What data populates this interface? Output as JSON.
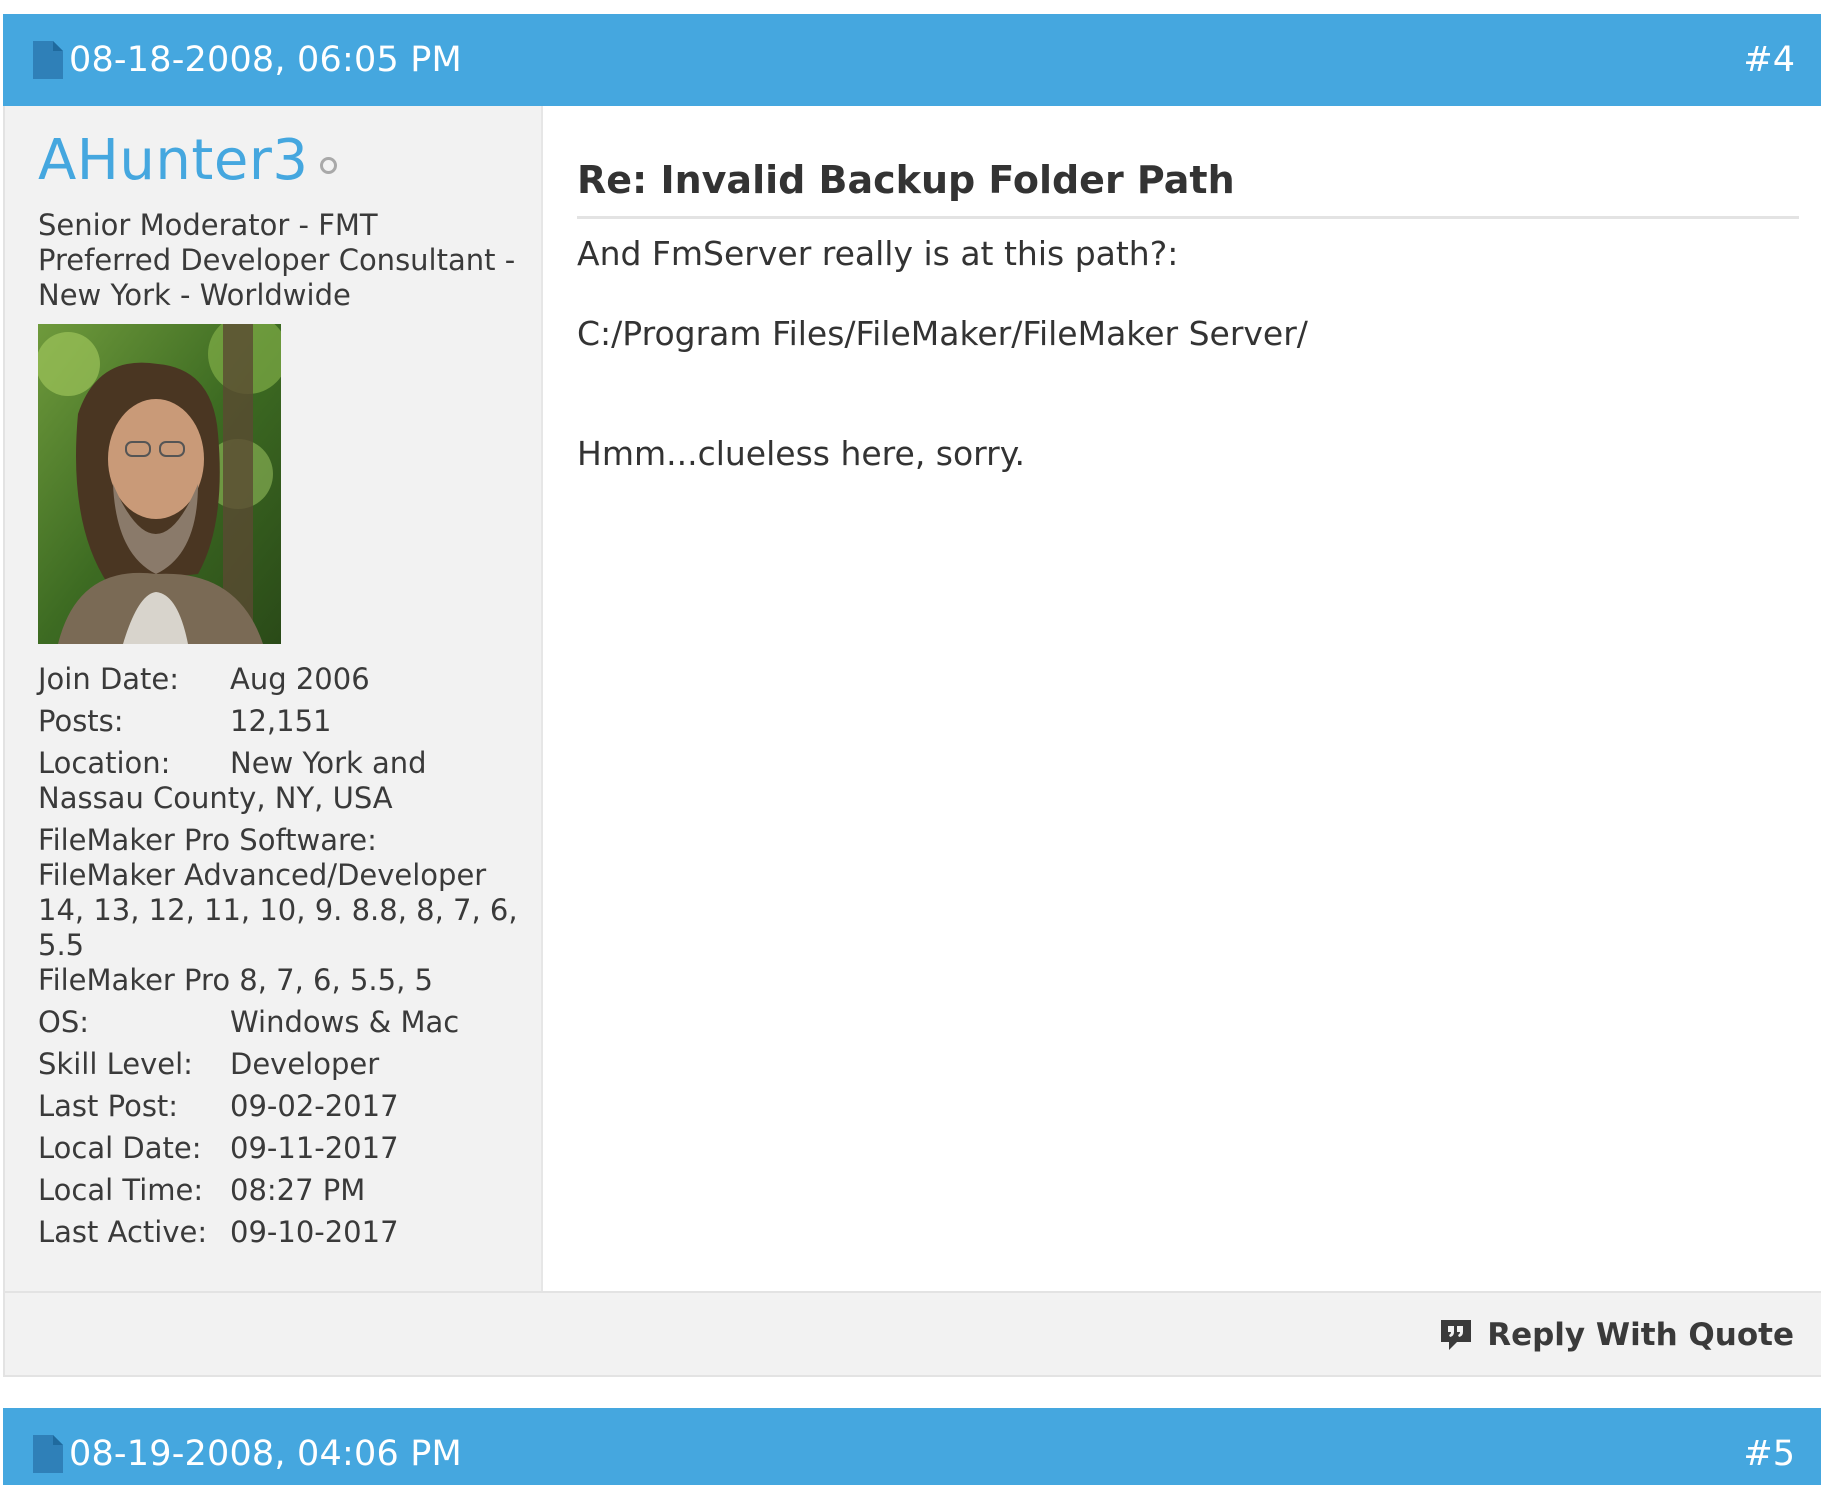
{
  "posts": [
    {
      "date": "08-18-2008, 06:05 PM",
      "number": "#4",
      "author": {
        "username": "AHunter3",
        "title": "Senior Moderator - FMT Preferred Developer Consultant - New York - Worldwide",
        "info": {
          "join_date_label": "Join Date:",
          "join_date": "Aug 2006",
          "posts_label": "Posts:",
          "posts": "12,151",
          "location_label": "Location:",
          "location": "New York and Nassau County, NY, USA",
          "software_label": "FileMaker Pro Software:",
          "software_line1": "FileMaker Advanced/Developer",
          "software_line2": "14, 13, 12, 11, 10, 9. 8.8, 8, 7, 6, 5.5",
          "software_line3": "FileMaker Pro 8, 7, 6, 5.5, 5",
          "os_label": "OS:",
          "os": "Windows & Mac",
          "skill_label": "Skill Level:",
          "skill": "Developer",
          "last_post_label": "Last Post:",
          "last_post": "09-02-2017",
          "local_date_label": "Local Date:",
          "local_date": "09-11-2017",
          "local_time_label": "Local Time:",
          "local_time": "08:27 PM",
          "last_active_label": "Last Active:",
          "last_active": "09-10-2017"
        }
      },
      "title": "Re: Invalid Backup Folder Path",
      "message": {
        "line1": "And FmServer really is at this path?:",
        "line2": "C:/Program Files/FileMaker/FileMaker Server/",
        "line3": "Hmm...clueless here, sorry."
      },
      "footer": {
        "reply_with_quote": "Reply With Quote"
      }
    },
    {
      "date": "08-19-2008, 04:06 PM",
      "number": "#5"
    }
  ],
  "colors": {
    "header_bg": "#45a7df",
    "username": "#45a7df",
    "sidebar_bg": "#f2f2f2"
  },
  "icons": {
    "date_icon": "document-icon",
    "reply_icon": "quote-bubble-icon",
    "status_icon": "offline-status-icon"
  }
}
